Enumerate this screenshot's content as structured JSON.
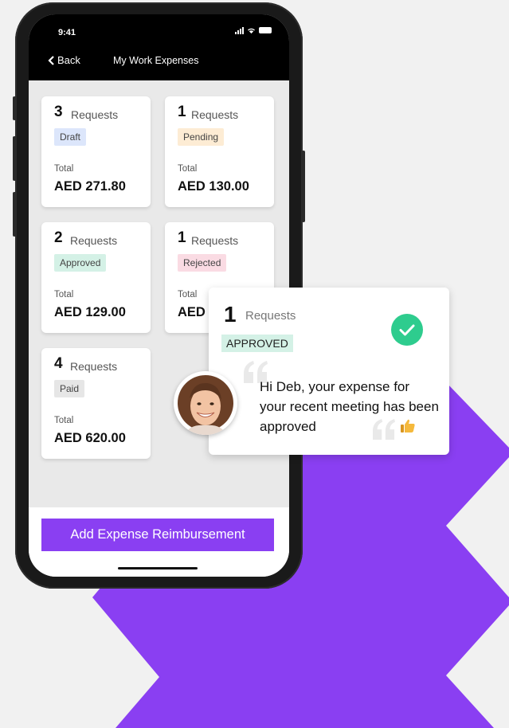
{
  "status_bar": {
    "time": "9:41"
  },
  "nav": {
    "back_label": "Back",
    "title": "My Work Expenses"
  },
  "cards": [
    {
      "count": "3",
      "requests_label": "Requests",
      "status": "Draft",
      "total_label": "Total",
      "amount": "AED 271.80",
      "badge_color": "#dce6fb"
    },
    {
      "count": "1",
      "requests_label": "Requests",
      "status": "Pending",
      "total_label": "Total",
      "amount": "AED 130.00",
      "badge_color": "#fdecd4"
    },
    {
      "count": "2",
      "requests_label": "Requests",
      "status": "Approved",
      "total_label": "Total",
      "amount": "AED 129.00",
      "badge_color": "#d4f1e6"
    },
    {
      "count": "1",
      "requests_label": "Requests",
      "status": "Rejected",
      "total_label": "Total",
      "amount": "AED",
      "badge_color": "#fadbe3"
    },
    {
      "count": "4",
      "requests_label": "Requests",
      "status": "Paid",
      "total_label": "Total",
      "amount": "AED 620.00",
      "badge_color": "#e6e6e6"
    }
  ],
  "cta": {
    "label": "Add Expense Reimbursement",
    "color": "#8a3ff2"
  },
  "notification": {
    "count": "1",
    "requests_label": "Requests",
    "status": "APPROVED",
    "message": "Hi Deb, your expense for your recent meeting has been approved",
    "check_color": "#2ecc8e",
    "icons": [
      "check-icon",
      "quote-icon",
      "thumbs-up-icon"
    ]
  },
  "accent": "#8a3ff2"
}
